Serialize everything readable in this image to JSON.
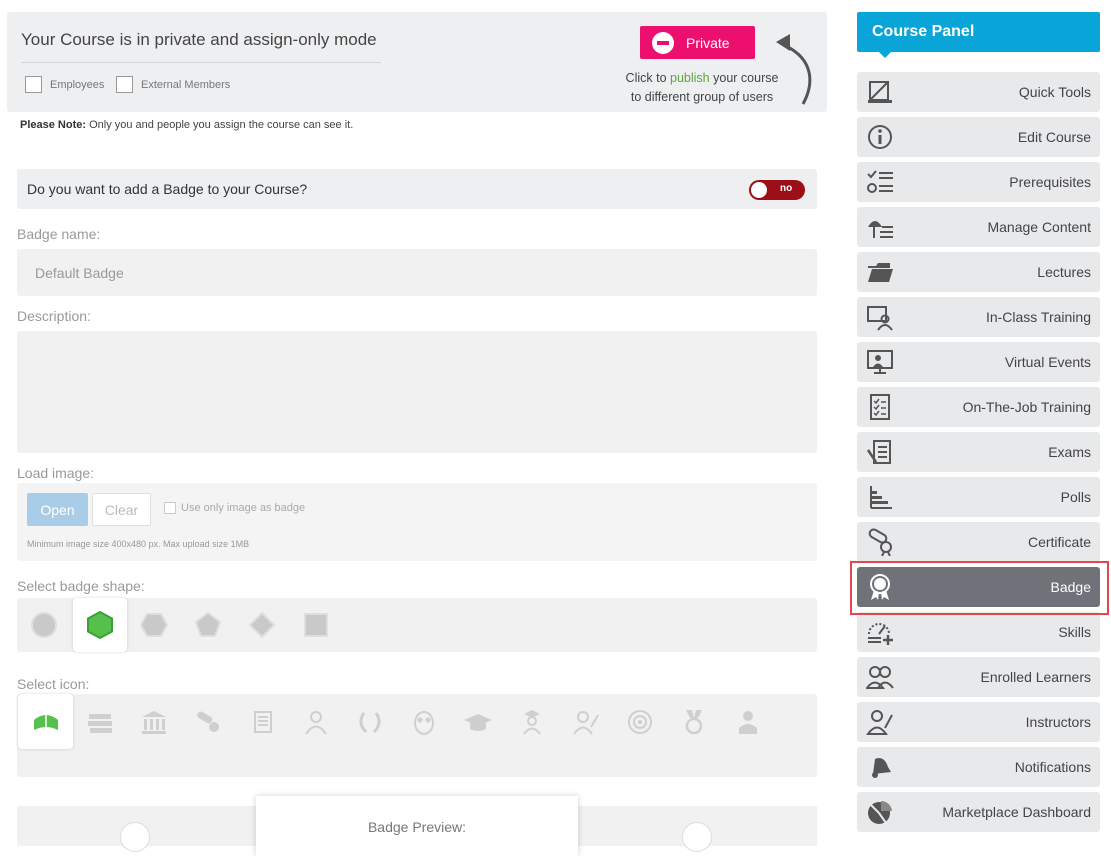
{
  "banner": {
    "title": "Your Course is in private and assign-only mode",
    "employees_label": "Employees",
    "external_label": "External Members",
    "private_button": "Private",
    "publish_prefix": "Click to",
    "publish_link": "publish",
    "publish_suffix": "your course",
    "publish_line2": "to different group of users"
  },
  "note": {
    "bold": "Please Note:",
    "text": "Only you and people you assign the course can see it."
  },
  "badge": {
    "question": "Do you want to add a Badge to your Course?",
    "toggle_label": "no",
    "name_label": "Badge name:",
    "name_placeholder": "Default Badge",
    "description_label": "Description:",
    "load_image_label": "Load image:",
    "open_button": "Open",
    "clear_button": "Clear",
    "only_image_label": "Use only image as badge",
    "min_size_text": "Minimum image size 400x480 px. Max upload size 1MB",
    "shape_label": "Select badge shape:",
    "icon_label": "Select icon:",
    "preview_label": "Badge Preview:"
  },
  "colors": {
    "accent": "#0aa5d8",
    "private": "#ec0f6e",
    "toggle_off": "#9d0f17",
    "selected_shape": "#55c04c",
    "active_item": "#6f7279",
    "highlight": "#e2474b"
  },
  "panel": {
    "title": "Course Panel",
    "items": [
      {
        "label": "Quick Tools",
        "icon": "quick-tools-icon"
      },
      {
        "label": "Edit Course",
        "icon": "info-icon"
      },
      {
        "label": "Prerequisites",
        "icon": "checklist-icon"
      },
      {
        "label": "Manage Content",
        "icon": "content-icon"
      },
      {
        "label": "Lectures",
        "icon": "folder-icon"
      },
      {
        "label": "In-Class Training",
        "icon": "classroom-icon"
      },
      {
        "label": "Virtual Events",
        "icon": "virtual-icon"
      },
      {
        "label": "On-The-Job Training",
        "icon": "clipboard-icon"
      },
      {
        "label": "Exams",
        "icon": "exam-icon"
      },
      {
        "label": "Polls",
        "icon": "poll-icon"
      },
      {
        "label": "Certificate",
        "icon": "certificate-icon"
      },
      {
        "label": "Badge",
        "icon": "badge-icon"
      },
      {
        "label": "Skills",
        "icon": "skills-icon"
      },
      {
        "label": "Enrolled Learners",
        "icon": "learners-icon"
      },
      {
        "label": "Instructors",
        "icon": "instructor-icon"
      },
      {
        "label": "Notifications",
        "icon": "bell-icon"
      },
      {
        "label": "Marketplace Dashboard",
        "icon": "pie-chart-icon"
      }
    ]
  }
}
